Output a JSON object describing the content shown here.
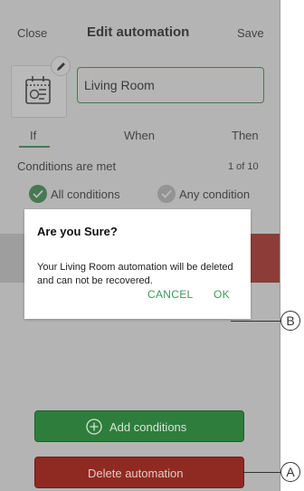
{
  "header": {
    "close_label": "Close",
    "title": "Edit automation",
    "save_label": "Save"
  },
  "automation": {
    "icon": "scene-icon",
    "edit_icon": "pencil-icon",
    "name_value": "Living Room"
  },
  "tabs": [
    {
      "label": "If",
      "active": true
    },
    {
      "label": "When",
      "active": false
    },
    {
      "label": "Then",
      "active": false
    }
  ],
  "conditions": {
    "title": "Conditions are met",
    "count": "1 of 10",
    "options": [
      {
        "label": "All conditions",
        "selected": true
      },
      {
        "label": "Any condition",
        "selected": false
      }
    ]
  },
  "buttons": {
    "add_conditions_label": "Add conditions",
    "add_icon": "plus-circle-icon",
    "delete_label": "Delete automation"
  },
  "dialog": {
    "title": "Are you Sure?",
    "message": "Your Living Room automation will be deleted and can not be recovered.",
    "cancel_label": "CANCEL",
    "ok_label": "OK"
  },
  "callouts": {
    "a": "A",
    "b": "B"
  },
  "colors": {
    "accent_green": "#3a8f4a",
    "delete_red": "#b0281f"
  }
}
